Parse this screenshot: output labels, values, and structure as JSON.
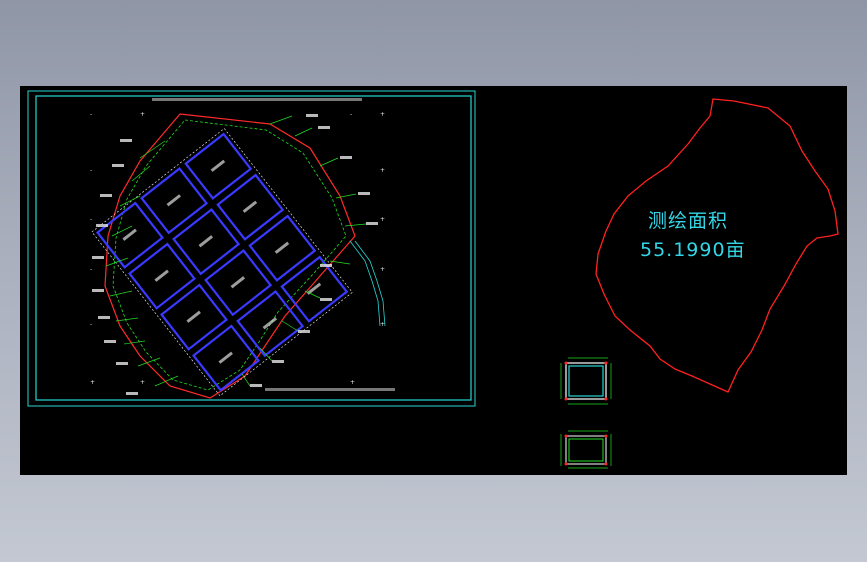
{
  "drawing": {
    "area_title": "测绘面积",
    "area_value": "55.1990亩"
  },
  "colors": {
    "background": "#000000",
    "frame": "#2ad4d4",
    "boundary": "#ff2a2a",
    "annotation": "#33d6e6",
    "grid_lines": "#3a3aff",
    "leaders": "#22dd22"
  }
}
